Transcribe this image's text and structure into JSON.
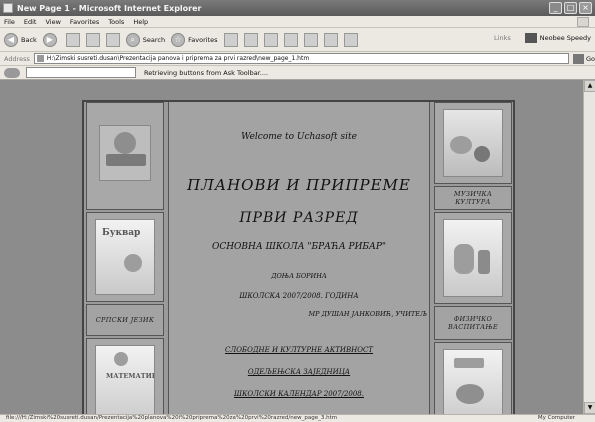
{
  "window": {
    "title": "New Page 1 - Microsoft Internet Explorer",
    "buttons": [
      "_",
      "□",
      "×"
    ]
  },
  "menu": [
    "File",
    "Edit",
    "View",
    "Favorites",
    "Tools",
    "Help"
  ],
  "toolbar": {
    "back_label": "Back",
    "search_label": "Search",
    "favorites_label": "Favorites",
    "links_label": "Links",
    "neobee_label": "Neobee Speedy"
  },
  "address": {
    "label": "Address",
    "value": "H:\\Zimski susreti.dusan\\Prezentacija panova i priprema za prvi razred\\new_page_1.htm",
    "go_label": "Go"
  },
  "ask": {
    "message": "Retrieving buttons from Ask Toolbar...."
  },
  "page": {
    "welcome": "Welcome to Uchasoft site",
    "heading1": "ПЛАНОВИ И ПРИПРЕМЕ",
    "heading2": "ПРВИ РАЗРЕД",
    "school": "ОСНОВНА ШКОЛА \"БРАЋА РИБАР\"",
    "place": "ДОЊА БОРИНА",
    "year": "ШКОЛСКА 2007/2008. ГОДИНА",
    "author": "МР ДУШАН ЈАНКОВИЋ, УЧИТЕЉ",
    "links": [
      "СЛОБОДНЕ И КУЛТУРНЕ АКТИВНОСТ",
      "ОДЕЉЕЊСКА ЗАЈЕДНИЦА",
      "ШКОЛСКИ КАЛЕНДАР 2007/2008."
    ]
  },
  "left_cells": {
    "book_title": "Буквар",
    "serbian_caption": "СРПСКИ ЈЕЗИК",
    "math_title": "МАТЕМАТИКА"
  },
  "right_cells": {
    "music_caption": "МУЗИЧКА КУЛТУРА",
    "pe_caption": "ФИЗИЧКО ВАСПИТАЊЕ"
  },
  "status": {
    "url": "file:///H:/Zimski%20susreti.dusan/Prezentacija%20planova%20i%20priprema%20za%20prvi%20razred/new_page_3.htm",
    "zone": "My Computer"
  }
}
